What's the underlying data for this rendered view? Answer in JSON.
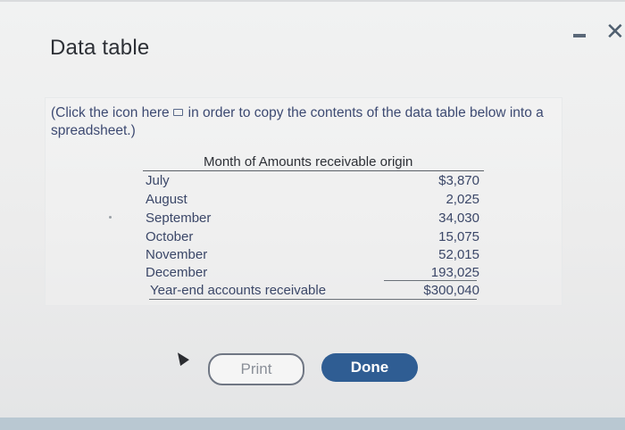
{
  "dialog": {
    "title": "Data table",
    "instruction_part1": "(Click the icon here",
    "instruction_part2": "in order to copy the contents of the data table below into a spreadsheet.)"
  },
  "table": {
    "header": "Month of Amounts receivable origin",
    "rows": [
      {
        "label": "July",
        "value": "$3,870"
      },
      {
        "label": "August",
        "value": "2,025"
      },
      {
        "label": "September",
        "value": "34,030"
      },
      {
        "label": "October",
        "value": "15,075"
      },
      {
        "label": "November",
        "value": "52,015"
      },
      {
        "label": "December",
        "value": "193,025"
      },
      {
        "label": "Year-end accounts receivable",
        "value": "$300,040"
      }
    ]
  },
  "buttons": {
    "print_label": "Print",
    "done_label": "Done"
  },
  "window_controls": {
    "close_glyph": "✕"
  },
  "icons": [
    "minimize-icon",
    "close-icon",
    "copy-icon",
    "cursor-icon"
  ]
}
